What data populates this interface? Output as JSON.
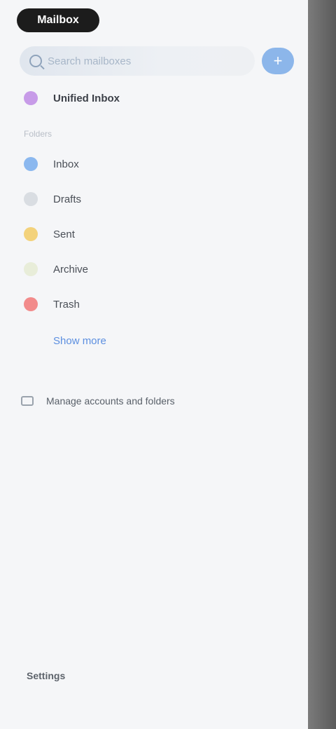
{
  "app": {
    "title": "Mailbox"
  },
  "search": {
    "placeholder": "Search mailboxes",
    "compose_label": "+"
  },
  "sections": {
    "divider": "Folders"
  },
  "items": [
    {
      "label": "Unified Inbox",
      "color": "#c79be8"
    },
    {
      "label": "Inbox",
      "color": "#8bb8ef"
    },
    {
      "label": "Drafts",
      "color": "#d9dde2"
    },
    {
      "label": "Sent",
      "color": "#f3d27b"
    },
    {
      "label": "Archive",
      "color": "#e8edd9"
    },
    {
      "label": "Trash",
      "color": "#f28b8b"
    }
  ],
  "more": {
    "label": "Show more"
  },
  "manage": {
    "label": "Manage accounts and folders"
  },
  "footer": {
    "label": "Settings"
  }
}
